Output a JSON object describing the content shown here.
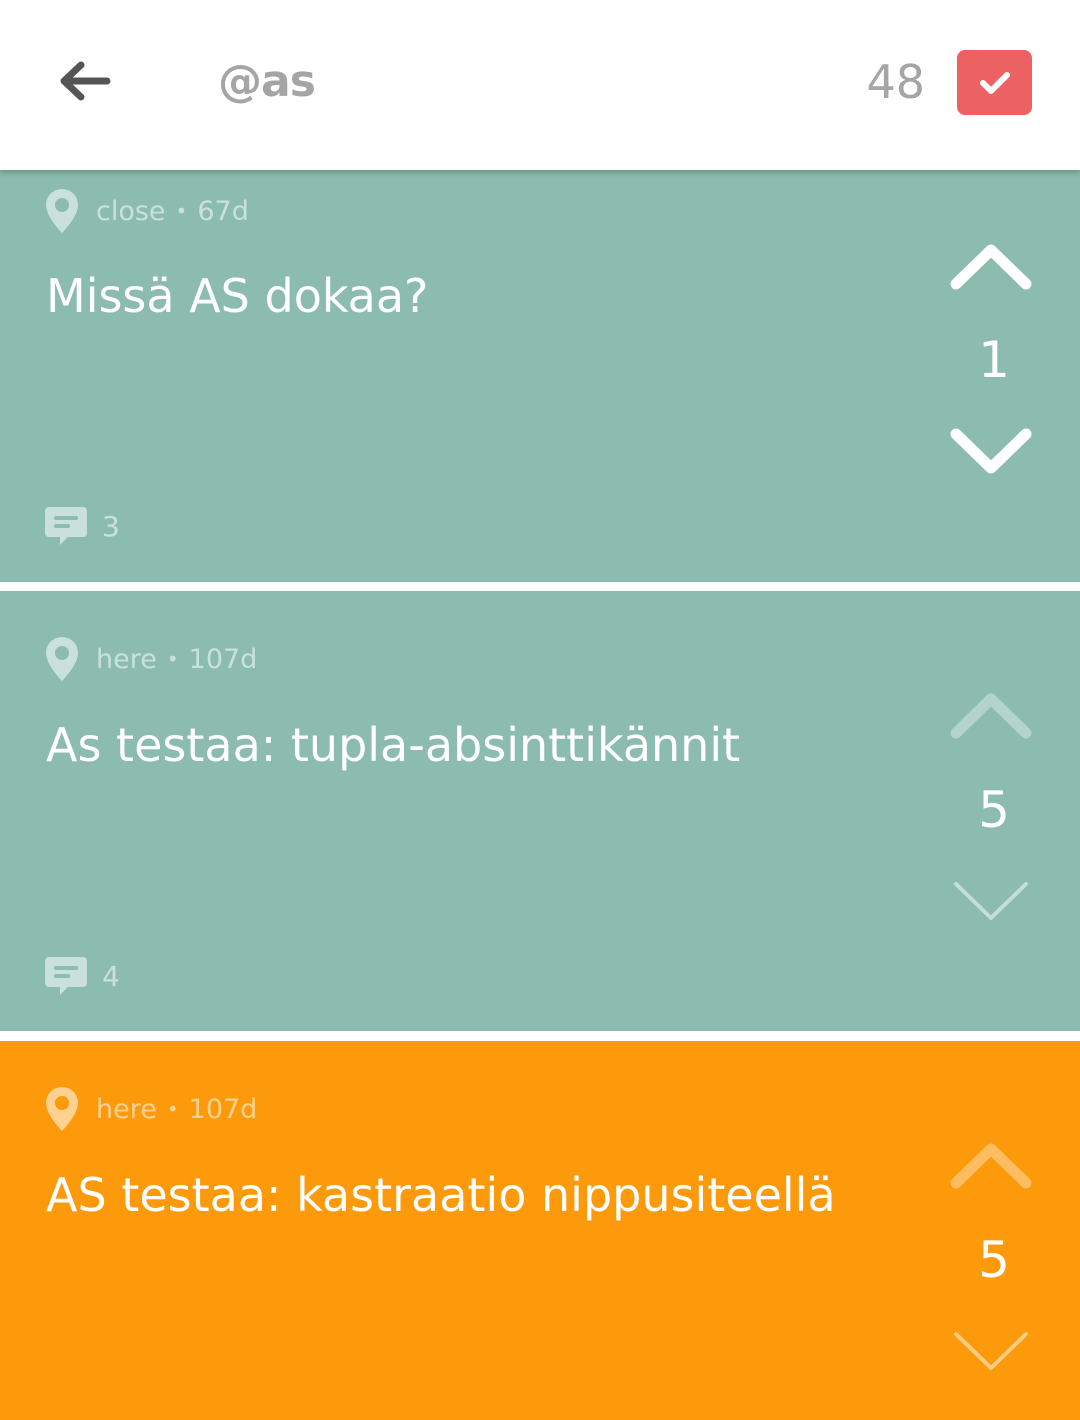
{
  "colors": {
    "teal": "#8bbcaf",
    "orange": "#fd9a0b",
    "accent": "#ec6161",
    "header_text": "#a5a5a5",
    "back_arrow": "#555555"
  },
  "header": {
    "back_icon": "arrow-left-icon",
    "handle": "@as",
    "karma": "48",
    "check_icon": "checkmark-icon"
  },
  "posts": [
    {
      "location": "close",
      "age": "67d",
      "text": "Missä AS dokaa?",
      "score": "1",
      "comments": "3",
      "color": "teal",
      "vote_state": "neutral"
    },
    {
      "location": "here",
      "age": "107d",
      "text": "As testaa: tupla-absinttikännit",
      "score": "5",
      "comments": "4",
      "color": "teal",
      "vote_state": "upvoted"
    },
    {
      "location": "here",
      "age": "107d",
      "text": "AS testaa: kastraatio nippusiteellä",
      "score": "5",
      "comments": "",
      "color": "orange",
      "vote_state": "upvoted"
    }
  ]
}
